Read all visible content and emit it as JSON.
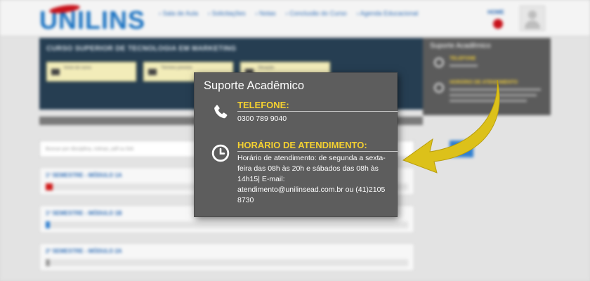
{
  "background": {
    "logo": "UNILINS",
    "nav": [
      "Sala de Aula",
      "Solicitações",
      "Notas",
      "Conclusão do Curso",
      "Agenda Educacional"
    ],
    "home_link": "HOME",
    "course_title": "CURSO SUPERIOR DE TECNOLOGIA EM MARKETING",
    "info_cards": [
      "Início do curso",
      "Término previsto",
      "Situação"
    ],
    "search_placeholder": "Buscar por disciplina, rotinas, pdf ou link",
    "support_title": "Suporte Acadêmico",
    "support_phone_label": "TELEFONE",
    "support_hours_label": "HORÁRIO DE ATENDIMENTO",
    "modules": [
      {
        "title": "1º SEMESTRE - MÓDULO 1A",
        "progress": 0.02,
        "color": "#d01a1a"
      },
      {
        "title": "1º SEMESTRE - MÓDULO 1B",
        "progress": 0.01,
        "color": "#2f7fd0"
      },
      {
        "title": "2º SEMESTRE - MÓDULO 2A",
        "progress": 0.0,
        "color": "#9a9a9a"
      }
    ]
  },
  "popup": {
    "title": "Suporte Acadêmico",
    "phone_heading": "TELEFONE:",
    "phone_number": "0300 789 9040",
    "hours_heading": "HORÁRIO DE ATENDIMENTO:",
    "hours_text": "Horário de atendimento: de segunda a sexta-feira das 08h às 20h e sábados das 08h às 14h15| E-mail: atendimento@unilinsead.com.br ou (41)2105 8730",
    "phone_icon": "phone-icon",
    "clock_icon": "clock-icon"
  },
  "colors": {
    "accent": "#f5d130",
    "arrow": "#dcc11a",
    "popup_bg": "#5d5d5d",
    "panel_bg": "#263e52"
  }
}
